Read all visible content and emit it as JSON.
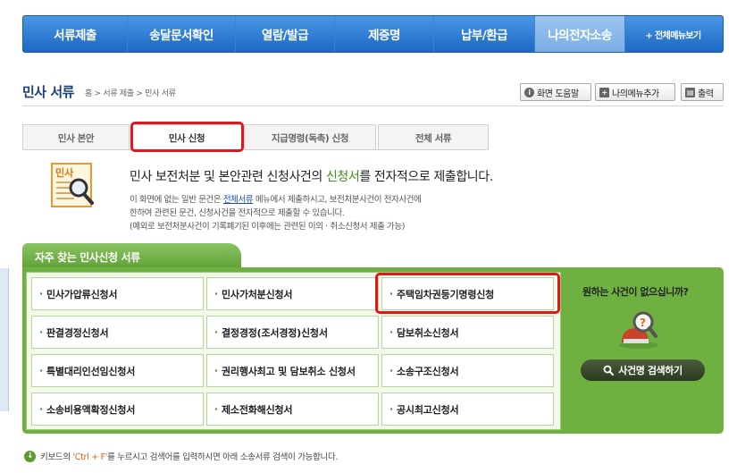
{
  "nav": {
    "items": [
      "서류제출",
      "송달문서확인",
      "열람/발급",
      "제증명",
      "납부/환급",
      "나의전자소송"
    ],
    "all_menu": "+ 전체메뉴보기",
    "active_index": 5
  },
  "page": {
    "title": "민사 서류",
    "breadcrumb": "홈 > 서류 제출 > 민사 서류"
  },
  "utils": {
    "help": "화면 도움말",
    "add_menu": "나의메뉴추가",
    "print": "출력"
  },
  "tabs": [
    "민사 본안",
    "민사 신청",
    "지급명령(독촉) 신청",
    "전체 서류"
  ],
  "active_tab": 1,
  "intro": {
    "icon_label": "민사",
    "head_pre": "민사 보전처분 및 본안관련 신청사건의 ",
    "head_hl": "신청서",
    "head_post": "를 전자적으로 제출합니다.",
    "line1_pre": "이 화면에 없는 일반 문건은 ",
    "line1_link": "전체서류",
    "line1_post": " 메뉴에서 제출하시고, 보전처분사건이 전자사건에",
    "line2": "한하여 관련된 문건, 신청사건을 전자적으로 제출할 수 있습니다.",
    "line3": "(예외로 보전처분사건이 기록폐기된 이후에는 관련된 이의 · 취소신청서 제출 가능)"
  },
  "favorites": {
    "title": "자주 찾는 민사신청 서류",
    "items": [
      "민사가압류신청서",
      "민사가처분신청서",
      "주택임차권등기명령신청",
      "판결경정신청서",
      "결정경정(조서경정)신청서",
      "담보취소신청서",
      "특별대리인선임신청서",
      "권리행사최고 및 담보취소 신청서",
      "소송구조신청서",
      "소송비용액확정신청서",
      "제소전화해신청서",
      "공시최고신청서"
    ]
  },
  "side": {
    "question": "원하는 사건이 없으십니까?",
    "search_button": "사건명 검색하기"
  },
  "hint": {
    "pre": "키보드의 ",
    "key": "'Ctrl + F'",
    "post": "를 누르시고 검색어를 입력하시면 아래 소송서류 검색이 가능합니다."
  }
}
